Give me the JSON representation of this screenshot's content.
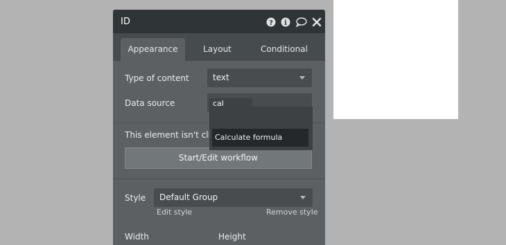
{
  "panel": {
    "title": "ID",
    "header_icons": [
      "help-icon",
      "info-icon",
      "comment-icon",
      "close-icon"
    ],
    "tabs": [
      {
        "label": "Appearance",
        "active": true
      },
      {
        "label": "Layout",
        "active": false
      },
      {
        "label": "Conditional",
        "active": false
      }
    ]
  },
  "appearance": {
    "type_of_content_label": "Type of content",
    "type_of_content_value": "text",
    "data_source_label": "Data source",
    "data_source_typed": "cal",
    "clickable_notice": "This element isn't clickab",
    "workflow_button": "Start/Edit workflow",
    "style_label": "Style",
    "style_value": "Default Group",
    "edit_style": "Edit style",
    "remove_style": "Remove style",
    "bottom_left_label": "Width",
    "bottom_right_label": "Height"
  },
  "autocomplete": {
    "suggestion": "Calculate formula"
  },
  "colors": {
    "canvas": "#b3b3b3",
    "panel_bg": "#5c6063",
    "header_bg": "#2f3437",
    "field_bg": "#484c4f"
  }
}
